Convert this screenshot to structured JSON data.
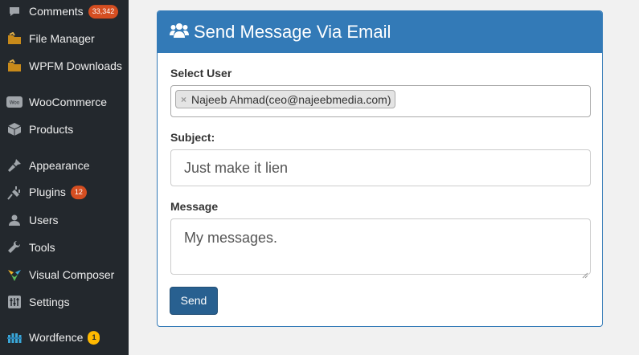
{
  "sidebar": {
    "items": [
      {
        "label": "Comments",
        "badge": "33,342",
        "icon": "comment-icon"
      },
      {
        "label": "File Manager",
        "icon": "file-manager-icon"
      },
      {
        "label": "WPFM Downloads",
        "icon": "downloads-icon"
      },
      {
        "label": "WooCommerce",
        "icon": "woocommerce-icon"
      },
      {
        "label": "Products",
        "icon": "products-icon"
      },
      {
        "label": "Appearance",
        "icon": "appearance-icon"
      },
      {
        "label": "Plugins",
        "badge": "12",
        "icon": "plugins-icon"
      },
      {
        "label": "Users",
        "icon": "users-icon"
      },
      {
        "label": "Tools",
        "icon": "tools-icon"
      },
      {
        "label": "Visual Composer",
        "icon": "visual-composer-icon"
      },
      {
        "label": "Settings",
        "icon": "settings-icon"
      },
      {
        "label": "Wordfence",
        "badge": "1",
        "icon": "wordfence-icon"
      }
    ]
  },
  "panel": {
    "title": "Send Message Via Email",
    "icon": "users-group-icon",
    "select_user_label": "Select User",
    "selected_user": "Najeeb Ahmad(ceo@najeebmedia.com)",
    "token_remove": "×",
    "subject_label": "Subject:",
    "subject_value": "Just make it lien",
    "message_label": "Message",
    "message_value": "My messages.",
    "send_label": "Send"
  },
  "colors": {
    "sidebar_bg": "#23282d",
    "panel_primary": "#337ab7",
    "button_bg": "#286090",
    "badge_red": "#d54e21",
    "badge_yellow": "#ffb900"
  }
}
